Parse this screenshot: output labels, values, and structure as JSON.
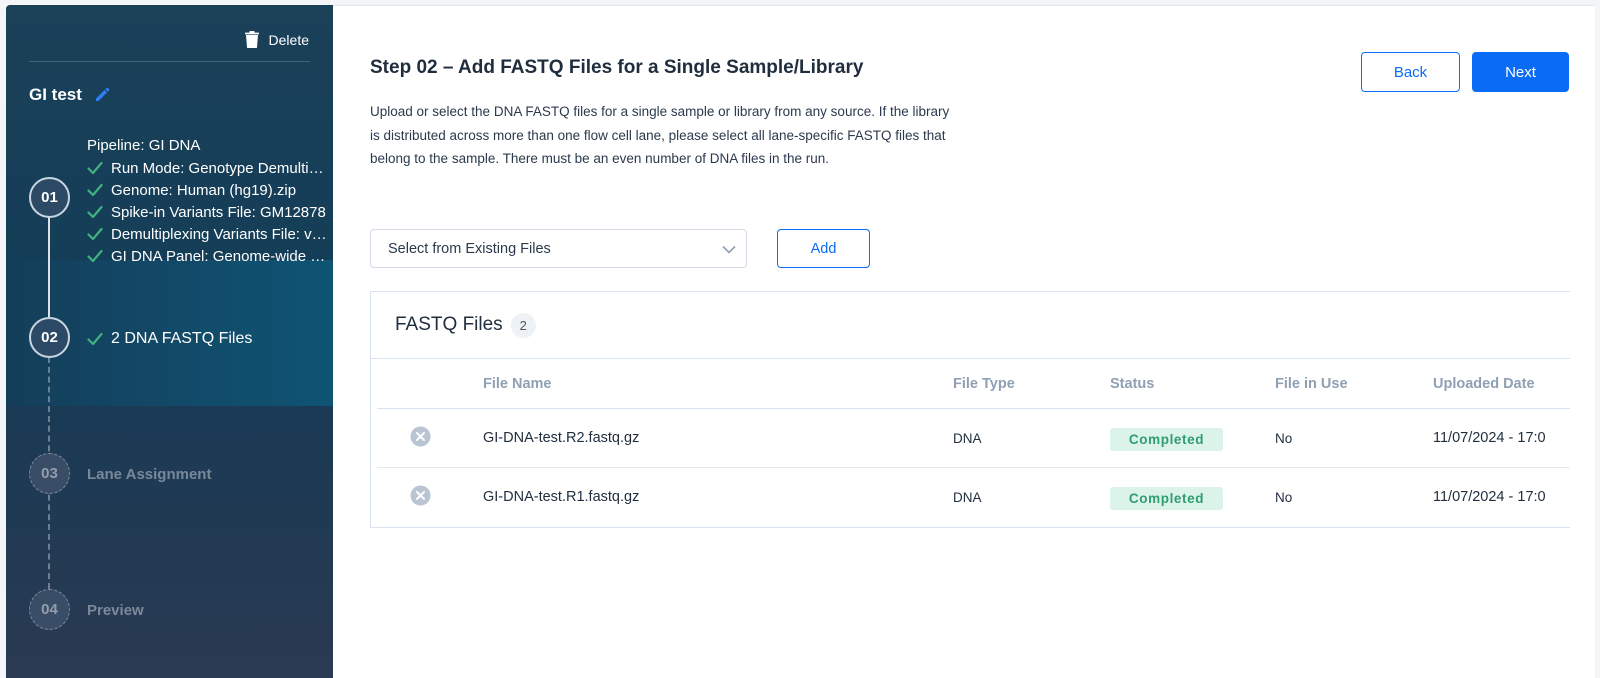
{
  "sidebar": {
    "delete_label": "Delete",
    "run_name": "GI test",
    "steps": [
      {
        "number": "01",
        "pipeline": "Pipeline: GI DNA",
        "items": [
          "Run Mode: Genotype Demultiplexing",
          "Genome: Human (hg19).zip",
          "Spike-in Variants File: GM12878",
          "Demultiplexing Variants File: variants",
          "GI DNA Panel: Genome-wide panel"
        ]
      },
      {
        "number": "02",
        "items": [
          "2 DNA FASTQ Files"
        ]
      },
      {
        "number": "03",
        "title": "Lane Assignment"
      },
      {
        "number": "04",
        "title": "Preview"
      }
    ]
  },
  "main": {
    "title": "Step 02 – Add FASTQ Files for a Single Sample/Library",
    "description": "Upload or select the DNA FASTQ files for a single sample or library from any source. If the library is distributed across more than one flow cell lane, please select all lane-specific FASTQ files that belong to the sample. There must be an even number of DNA files in the run.",
    "back_label": "Back",
    "next_label": "Next",
    "select_label": "Select from Existing Files",
    "add_label": "Add",
    "files": {
      "title": "FASTQ Files",
      "count": "2",
      "columns": [
        "File Name",
        "File Type",
        "Status",
        "File in Use",
        "Uploaded Date"
      ],
      "rows": [
        {
          "name": "GI-DNA-test.R2.fastq.gz",
          "type": "DNA",
          "status": "Completed",
          "in_use": "No",
          "date": "11/07/2024 - 17:0"
        },
        {
          "name": "GI-DNA-test.R1.fastq.gz",
          "type": "DNA",
          "status": "Completed",
          "in_use": "No",
          "date": "11/07/2024 - 17:0"
        }
      ]
    }
  },
  "colors": {
    "accent": "#0a6cf5",
    "check": "#3fb27f",
    "status_bg": "#dcf3ea",
    "status_text": "#2e9e6f"
  }
}
